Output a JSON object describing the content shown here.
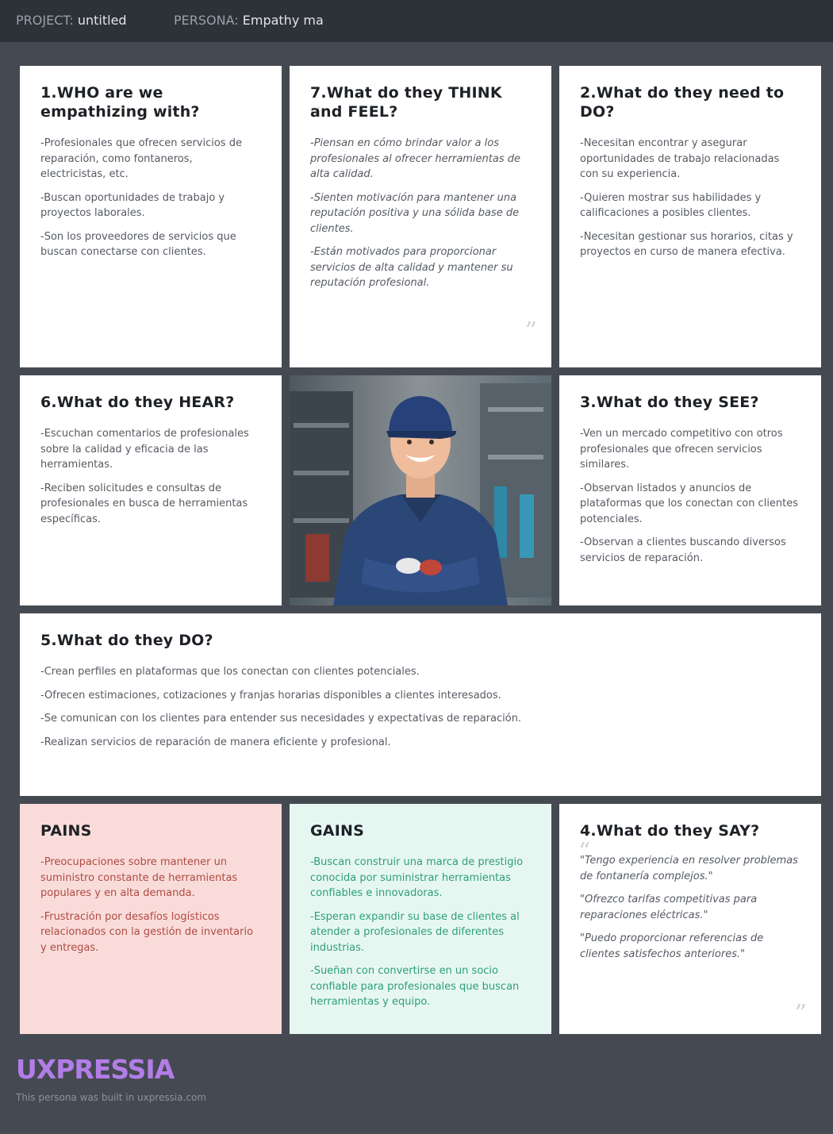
{
  "header": {
    "project_label": "PROJECT:",
    "project_value": "untitled",
    "persona_label": "PERSONA:",
    "persona_value": "Empathy ma"
  },
  "cards": {
    "who": {
      "title": "1.WHO are we empathizing with?",
      "items": [
        "-Profesionales que ofrecen servicios de reparación, como fontaneros, electricistas, etc.",
        "-Buscan oportunidades de trabajo y proyectos laborales.",
        "-Son los proveedores de servicios que buscan conectarse con clientes."
      ]
    },
    "think": {
      "title": "7.What do they THINK and FEEL?",
      "items": [
        "-Piensan en cómo brindar valor a los profesionales al ofrecer herramientas de alta calidad.",
        "-Sienten motivación para mantener una reputación positiva y una sólida base de clientes.",
        "-Están motivados para proporcionar servicios de alta calidad y mantener su reputación profesional."
      ]
    },
    "need": {
      "title": "2.What do they need to DO?",
      "items": [
        "-Necesitan encontrar y asegurar oportunidades de trabajo relacionadas con su experiencia.",
        "-Quieren mostrar sus habilidades y calificaciones a posibles clientes.",
        "-Necesitan gestionar sus horarios, citas y proyectos en curso de manera efectiva."
      ]
    },
    "hear": {
      "title": "6.What do they HEAR?",
      "items": [
        "-Escuchan comentarios de profesionales sobre la calidad y eficacia de las herramientas.",
        "-Reciben solicitudes e consultas de profesionales en busca de herramientas específicas."
      ]
    },
    "see": {
      "title": "3.What do they SEE?",
      "items": [
        "-Ven un mercado competitivo con otros profesionales que ofrecen servicios similares.",
        "-Observan listados y anuncios de plataformas que los conectan con clientes potenciales.",
        "-Observan a clientes buscando diversos servicios de reparación."
      ]
    },
    "do": {
      "title": "5.What do they DO?",
      "items": [
        "-Crean perfiles en plataformas que los conectan con clientes potenciales.",
        "-Ofrecen estimaciones, cotizaciones y franjas horarias disponibles a clientes interesados.",
        "-Se comunican con los clientes para entender sus necesidades y expectativas de reparación.",
        "-Realizan servicios de reparación de manera eficiente y profesional."
      ]
    },
    "pains": {
      "title": "PAINS",
      "items": [
        "-Preocupaciones sobre mantener un suministro constante de herramientas populares y en alta demanda.",
        "-Frustración por desafíos logísticos relacionados con la gestión de inventario y entregas."
      ]
    },
    "gains": {
      "title": "GAINS",
      "items": [
        "-Buscan construir una marca de prestigio conocida por suministrar herramientas confiables e innovadoras.",
        "-Esperan expandir su base de clientes al atender a profesionales de diferentes industrias.",
        "-Sueñan con convertirse en un socio confiable para profesionales que buscan herramientas y equipo."
      ]
    },
    "say": {
      "title": "4.What do they SAY?",
      "items": [
        "\"Tengo experiencia en resolver problemas de fontanería complejos.\"",
        "\"Ofrezco tarifas competitivas para reparaciones eléctricas.\"",
        "\"Puedo proporcionar referencias de clientes satisfechos anteriores.\""
      ]
    }
  },
  "quote_marks": {
    "open": "“",
    "close": "”"
  },
  "footer": {
    "logo": "UXPRESSIA",
    "note": "This persona was built in uxpressia.com"
  },
  "colors": {
    "background": "#454a52",
    "topbar": "#2d3138",
    "pains_bg": "#f9dcd9",
    "pains_text": "#b04a44",
    "gains_bg": "#e6f7f2",
    "gains_text": "#2e9e7a",
    "logo": "#b37de8"
  }
}
